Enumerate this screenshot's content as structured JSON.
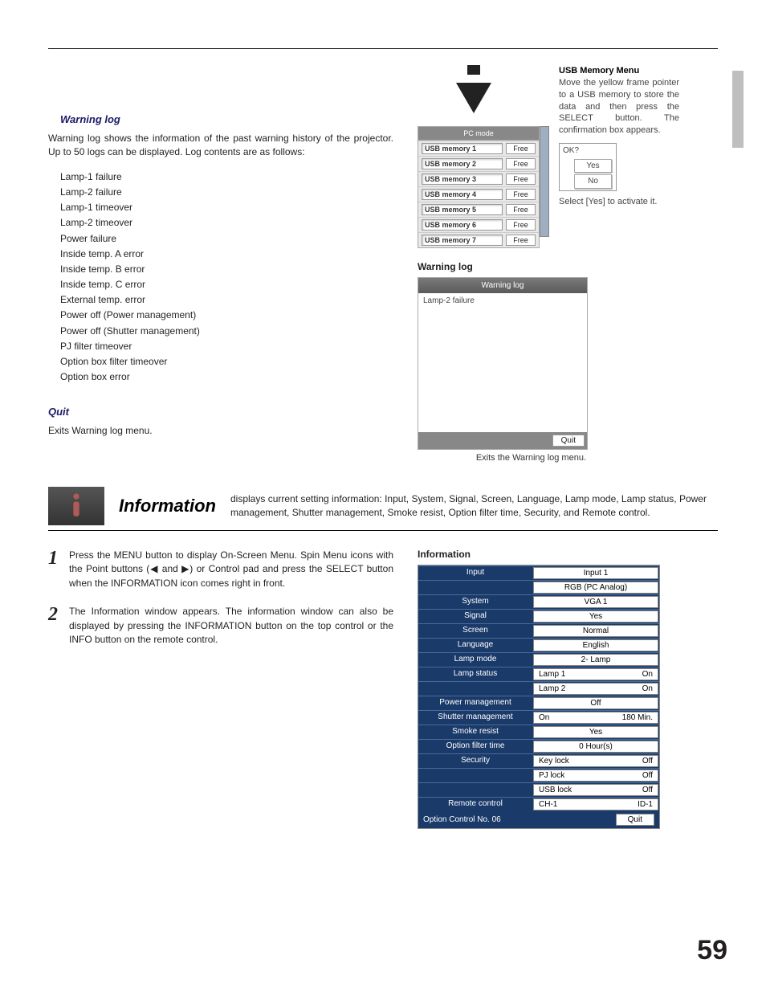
{
  "hr_top": true,
  "warning_log": {
    "heading": "Warning log",
    "intro": "Warning log shows the information of the past warning history of the projector.  Up to 50 logs can be displayed. Log contents are as follows:",
    "items": [
      "Lamp-1 failure",
      "Lamp-2 failure",
      "Lamp-1 timeover",
      "Lamp-2 timeover",
      "Power failure",
      "Inside temp. A error",
      "Inside temp. B error",
      "Inside temp. C error",
      "External temp. error",
      "Power off (Power management)",
      "Power off (Shutter management)",
      "PJ filter timeover",
      "Option box filter timeover",
      "Option box error"
    ]
  },
  "quit": {
    "heading": "Quit",
    "text": "Exits Warning log menu."
  },
  "usb": {
    "title": "PC  mode",
    "rows": [
      {
        "slot": "USB memory 1",
        "status": "Free"
      },
      {
        "slot": "USB memory 2",
        "status": "Free"
      },
      {
        "slot": "USB memory 3",
        "status": "Free"
      },
      {
        "slot": "USB memory 4",
        "status": "Free"
      },
      {
        "slot": "USB memory 5",
        "status": "Free"
      },
      {
        "slot": "USB memory 6",
        "status": "Free"
      },
      {
        "slot": "USB memory 7",
        "status": "Free"
      }
    ],
    "side_heading": "USB Memory Menu",
    "side_text": "Move the yellow frame pointer to a USB memory to store the data and then press the SELECT button.  The confirmation box appears.",
    "ok_label": "OK?",
    "yes": "Yes",
    "no": "No",
    "activate": "Select [Yes] to activate it."
  },
  "warn_panel": {
    "heading": "Warning log",
    "title_bar": "Warning log",
    "entry": "Lamp-2 failure",
    "quit": "Quit",
    "caption": "Exits the Warning log menu."
  },
  "information": {
    "title": "Information",
    "desc": "displays current setting information: Input, System, Signal, Screen, Language, Lamp mode, Lamp status, Power management, Shutter management, Smoke resist, Option filter time, Security, and Remote control.",
    "step1": "Press the MENU button to display On-Screen Menu. Spin Menu icons with the Point buttons (◀ and ▶) or Control pad and press the SELECT button when the INFORMATION icon comes right in front.",
    "step2": "The Information window appears. The information window can also be displayed by pressing the INFORMATION button on the top control or the INFO button on the remote control.",
    "panel_heading": "Information",
    "table": {
      "rows": [
        {
          "label": "Input",
          "value": "Input 1"
        },
        {
          "label": "",
          "value": "RGB (PC Analog)"
        },
        {
          "label": "System",
          "value": "VGA 1"
        },
        {
          "label": "Signal",
          "value": "Yes"
        },
        {
          "label": "Screen",
          "value": "Normal"
        },
        {
          "label": "Language",
          "value": "English"
        },
        {
          "label": "Lamp mode",
          "value": "2- Lamp"
        },
        {
          "label": "Lamp status",
          "value_split": [
            "Lamp 1",
            "On"
          ]
        },
        {
          "label": "",
          "value_split": [
            "Lamp 2",
            "On"
          ]
        },
        {
          "label": "Power management",
          "value": "Off"
        },
        {
          "label": "Shutter management",
          "value_split": [
            "On",
            "180 Min."
          ]
        },
        {
          "label": "Smoke resist",
          "value": "Yes"
        },
        {
          "label": "Option filter time",
          "value": "0 Hour(s)"
        },
        {
          "label": "Security",
          "value_split": [
            "Key lock",
            "Off"
          ]
        },
        {
          "label": "",
          "value_split": [
            "PJ lock",
            "Off"
          ]
        },
        {
          "label": "",
          "value_split": [
            "USB lock",
            "Off"
          ]
        },
        {
          "label": "Remote control",
          "value_split": [
            "CH-1",
            "ID-1"
          ]
        }
      ],
      "footer_label": "Option Control No.  06",
      "footer_quit": "Quit"
    }
  },
  "page_number": "59"
}
